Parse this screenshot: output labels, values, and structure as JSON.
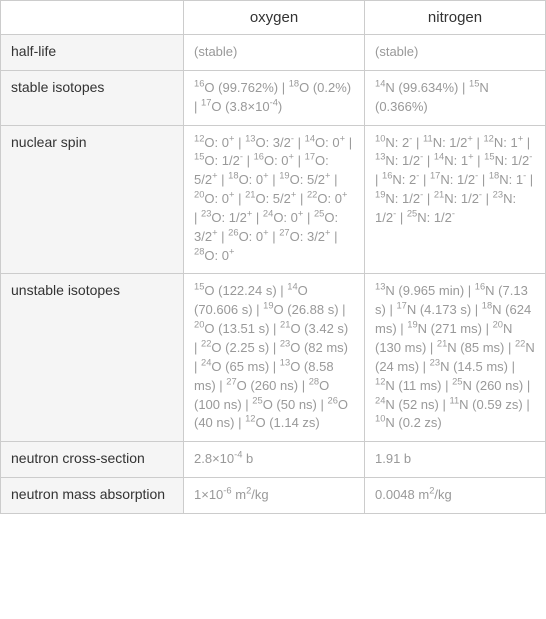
{
  "cols": [
    "oxygen",
    "nitrogen"
  ],
  "rows": {
    "half_life": {
      "label": "half-life",
      "oxygen": "(stable)",
      "nitrogen": "(stable)"
    },
    "stable_isotopes": {
      "label": "stable isotopes",
      "oxygen": "<sup>16</sup>O (99.762%) | <sup>18</sup>O (0.2%) | <sup>17</sup>O (3.8×10<sup>-4</sup>)",
      "nitrogen": "<sup>14</sup>N (99.634%) | <sup>15</sup>N (0.366%)"
    },
    "nuclear_spin": {
      "label": "nuclear spin",
      "oxygen": "<sup>12</sup>O: 0<sup>+</sup> | <sup>13</sup>O: 3/2<sup>-</sup> | <sup>14</sup>O: 0<sup>+</sup> | <sup>15</sup>O: 1/2<sup>-</sup> | <sup>16</sup>O: 0<sup>+</sup> | <sup>17</sup>O: 5/2<sup>+</sup> | <sup>18</sup>O: 0<sup>+</sup> | <sup>19</sup>O: 5/2<sup>+</sup> | <sup>20</sup>O: 0<sup>+</sup> | <sup>21</sup>O: 5/2<sup>+</sup> | <sup>22</sup>O: 0<sup>+</sup> | <sup>23</sup>O: 1/2<sup>+</sup> | <sup>24</sup>O: 0<sup>+</sup> | <sup>25</sup>O: 3/2<sup>+</sup> | <sup>26</sup>O: 0<sup>+</sup> | <sup>27</sup>O: 3/2<sup>+</sup> | <sup>28</sup>O: 0<sup>+</sup>",
      "nitrogen": "<sup>10</sup>N: 2<sup>-</sup> | <sup>11</sup>N: 1/2<sup>+</sup> | <sup>12</sup>N: 1<sup>+</sup> | <sup>13</sup>N: 1/2<sup>-</sup> | <sup>14</sup>N: 1<sup>+</sup> | <sup>15</sup>N: 1/2<sup>-</sup> | <sup>16</sup>N: 2<sup>-</sup> | <sup>17</sup>N: 1/2<sup>-</sup> | <sup>18</sup>N: 1<sup>-</sup> | <sup>19</sup>N: 1/2<sup>-</sup> | <sup>21</sup>N: 1/2<sup>-</sup> | <sup>23</sup>N: 1/2<sup>-</sup> | <sup>25</sup>N: 1/2<sup>-</sup>"
    },
    "unstable_isotopes": {
      "label": "unstable isotopes",
      "oxygen": "<sup>15</sup>O (122.24 s) | <sup>14</sup>O (70.606 s) | <sup>19</sup>O (26.88 s) | <sup>20</sup>O (13.51 s) | <sup>21</sup>O (3.42 s) | <sup>22</sup>O (2.25 s) | <sup>23</sup>O (82 ms) | <sup>24</sup>O (65 ms) | <sup>13</sup>O (8.58 ms) | <sup>27</sup>O (260 ns) | <sup>28</sup>O (100 ns) | <sup>25</sup>O (50 ns) | <sup>26</sup>O (40 ns) | <sup>12</sup>O (1.14 zs)",
      "nitrogen": "<sup>13</sup>N (9.965 min) | <sup>16</sup>N (7.13 s) | <sup>17</sup>N (4.173 s) | <sup>18</sup>N (624 ms) | <sup>19</sup>N (271 ms) | <sup>20</sup>N (130 ms) | <sup>21</sup>N (85 ms) | <sup>22</sup>N (24 ms) | <sup>23</sup>N (14.5 ms) | <sup>12</sup>N (11 ms) | <sup>25</sup>N (260 ns) | <sup>24</sup>N (52 ns) | <sup>11</sup>N (0.59 zs) | <sup>10</sup>N (0.2 zs)"
    },
    "neutron_cross_section": {
      "label": "neutron cross-section",
      "oxygen": "2.8×10<sup>-4</sup> b",
      "nitrogen": "1.91 b"
    },
    "neutron_mass_absorption": {
      "label": "neutron mass absorption",
      "oxygen": "1×10<sup>-6</sup> m<sup>2</sup>/kg",
      "nitrogen": "0.0048 m<sup>2</sup>/kg"
    }
  }
}
